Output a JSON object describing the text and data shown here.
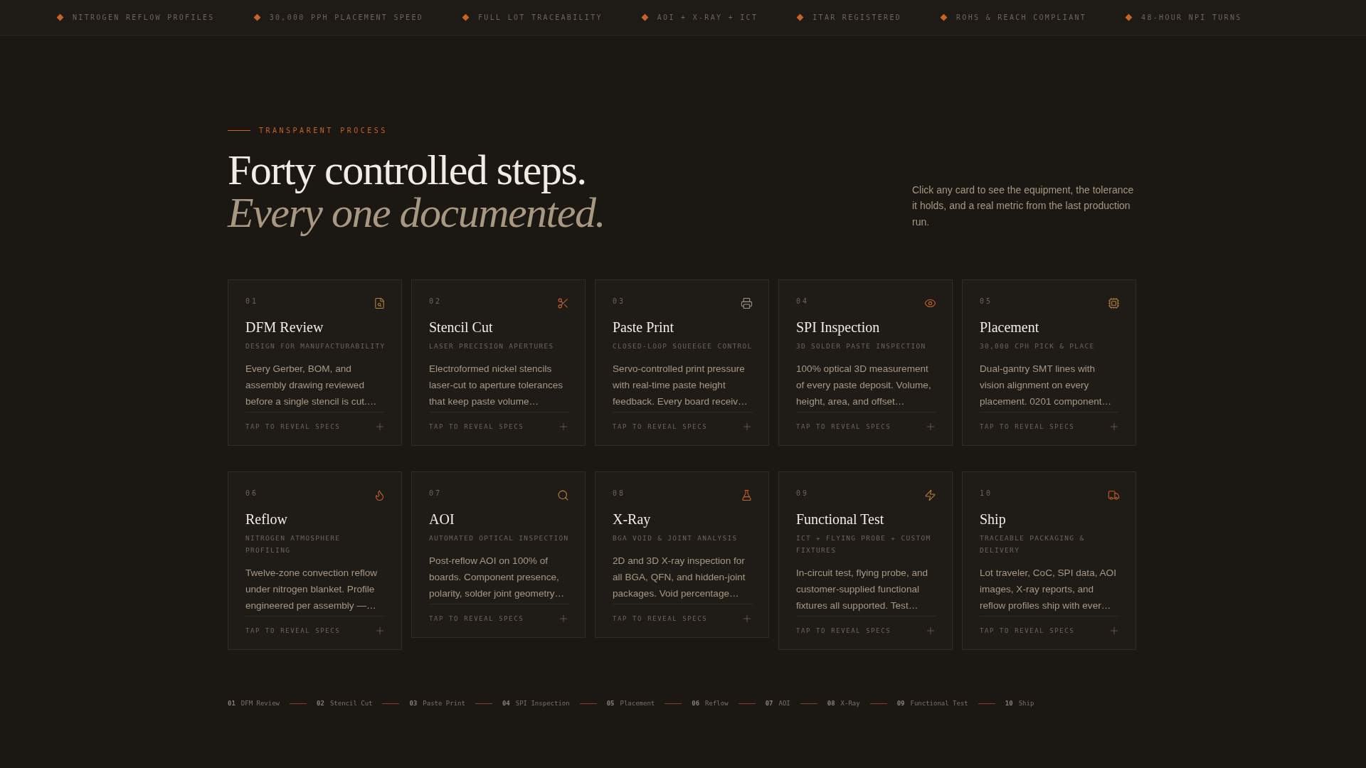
{
  "ticker": [
    "NITROGEN REFLOW PROFILES",
    "30,000 PPH PLACEMENT SPEED",
    "FULL LOT TRACEABILITY",
    "AOI + X-RAY + ICT",
    "ITAR REGISTERED",
    "ROHS & REACH COMPLIANT",
    "48-HOUR NPI TURNS"
  ],
  "header": {
    "eyebrow": "TRANSPARENT PROCESS",
    "title": "Forty controlled steps.",
    "title_italic": "Every one documented.",
    "description": "Click any card to see the equipment, the tolerance it holds, and a real metric from the last production run."
  },
  "cards": [
    {
      "number": "01",
      "kind": "file-search",
      "title": "DFM Review",
      "subtitle": "DESIGN FOR MANUFACTURABILITY",
      "body": "Every Gerber, BOM, and assembly drawing reviewed before a single stencil is cut.…",
      "action": "TAP TO REVEAL SPECS"
    },
    {
      "number": "02",
      "kind": "scissors",
      "title": "Stencil Cut",
      "subtitle": "LASER PRECISION APERTURES",
      "body": "Electroformed nickel stencils laser-cut to aperture tolerances that keep paste volume…",
      "action": "TAP TO REVEAL SPECS"
    },
    {
      "number": "03",
      "kind": "printer",
      "title": "Paste Print",
      "subtitle": "CLOSED-LOOP SQUEEGEE CONTROL",
      "body": "Servo-controlled print pressure with real-time paste height feedback. Every board receiv…",
      "action": "TAP TO REVEAL SPECS"
    },
    {
      "number": "04",
      "kind": "eye",
      "title": "SPI Inspection",
      "subtitle": "3D SOLDER PASTE INSPECTION",
      "body": "100% optical 3D measurement of every paste deposit. Volume, height, area, and offset…",
      "action": "TAP TO REVEAL SPECS"
    },
    {
      "number": "05",
      "kind": "chip",
      "title": "Placement",
      "subtitle": "30,000 CPH PICK & PLACE",
      "body": "Dual-gantry SMT lines with vision alignment on every placement. 0201 component…",
      "action": "TAP TO REVEAL SPECS"
    },
    {
      "number": "06",
      "kind": "flame",
      "title": "Reflow",
      "subtitle": "NITROGEN ATMOSPHERE PROFILING",
      "body": "Twelve-zone convection reflow under nitrogen blanket. Profile engineered per assembly —…",
      "action": "TAP TO REVEAL SPECS"
    },
    {
      "number": "07",
      "kind": "search",
      "title": "AOI",
      "subtitle": "AUTOMATED OPTICAL INSPECTION",
      "body": "Post-reflow AOI on 100% of boards. Component presence, polarity, solder joint geometry…",
      "action": "TAP TO REVEAL SPECS"
    },
    {
      "number": "08",
      "kind": "flask",
      "title": "X-Ray",
      "subtitle": "BGA VOID & JOINT ANALYSIS",
      "body": "2D and 3D X-ray inspection for all BGA, QFN, and hidden-joint packages. Void percentage…",
      "action": "TAP TO REVEAL SPECS"
    },
    {
      "number": "09",
      "kind": "zap",
      "title": "Functional Test",
      "subtitle": "ICT + FLYING PROBE + CUSTOM FIXTURES",
      "body": "In-circuit test, flying probe, and customer-supplied functional fixtures all supported. Test…",
      "action": "TAP TO REVEAL SPECS"
    },
    {
      "number": "10",
      "kind": "truck",
      "title": "Ship",
      "subtitle": "TRACEABLE PACKAGING & DELIVERY",
      "body": "Lot traveler, CoC, SPI data, AOI images, X-ray reports, and reflow profiles ship with ever…",
      "action": "TAP TO REVEAL SPECS"
    }
  ],
  "step_nav": [
    {
      "number": "01",
      "label": "DFM Review"
    },
    {
      "number": "02",
      "label": "Stencil Cut"
    },
    {
      "number": "03",
      "label": "Paste Print"
    },
    {
      "number": "04",
      "label": "SPI Inspection"
    },
    {
      "number": "05",
      "label": "Placement"
    },
    {
      "number": "06",
      "label": "Reflow"
    },
    {
      "number": "07",
      "label": "AOI"
    },
    {
      "number": "08",
      "label": "X-Ray"
    },
    {
      "number": "09",
      "label": "Functional Test"
    },
    {
      "number": "10",
      "label": "Ship"
    }
  ]
}
